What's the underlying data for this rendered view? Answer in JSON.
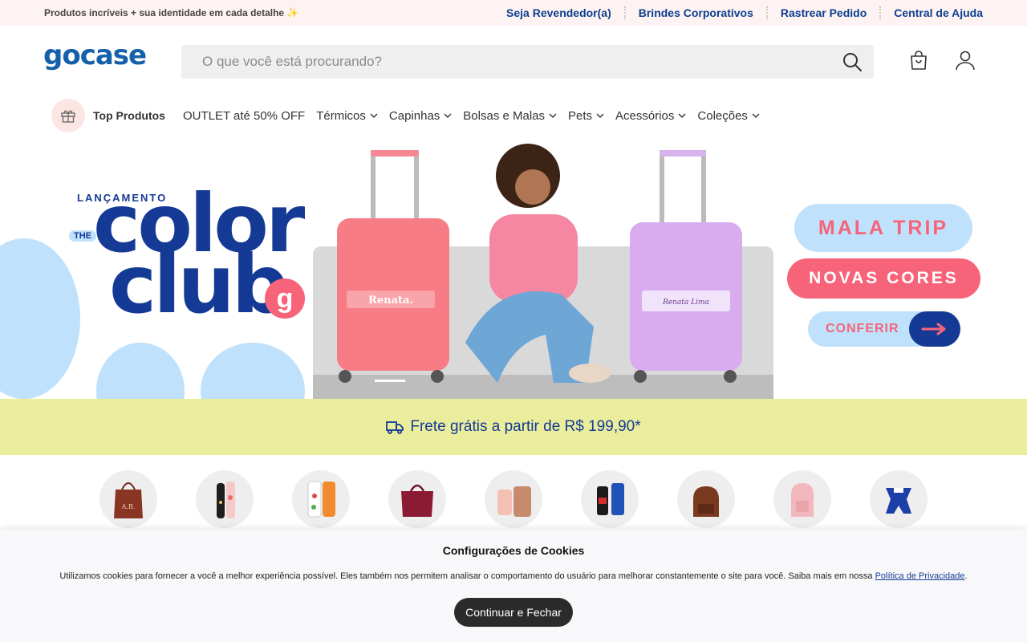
{
  "topbar": {
    "promo": "Produtos incríveis + sua identidade em cada detalhe ✨",
    "links": [
      "Seja Revendedor(a)",
      "Brindes Corporativos",
      "Rastrear Pedido",
      "Central de Ajuda"
    ]
  },
  "header": {
    "logo_text": "gocase",
    "search_placeholder": "O que você está procurando?"
  },
  "nav": {
    "top_label": "Top Produtos",
    "items": [
      "OUTLET até 50% OFF",
      "Térmicos",
      "Capinhas",
      "Bolsas e Malas",
      "Pets",
      "Acessórios",
      "Coleções"
    ]
  },
  "banner": {
    "launch": "LANÇAMENTO",
    "the": "THE",
    "color": "color",
    "club": "club",
    "badge": "g",
    "mala": "MALA TRIP",
    "novas": "NOVAS CORES",
    "cta": "CONFERIR",
    "luggage_name_1": "Renata.",
    "luggage_name_2": "Renata Lima",
    "slides": 2,
    "active_slide": 1
  },
  "shipping": {
    "text": "Frete grátis a partir de R$ 199,90*"
  },
  "categories": [
    {
      "icon": "tote-bag-icon",
      "initials": "A.B."
    },
    {
      "icon": "bottles-icon"
    },
    {
      "icon": "phone-cases-icon"
    },
    {
      "icon": "travel-bag-icon"
    },
    {
      "icon": "luggage-set-icon"
    },
    {
      "icon": "tumblers-icon"
    },
    {
      "icon": "backpack-icon"
    },
    {
      "icon": "pink-backpack-icon"
    },
    {
      "icon": "pet-harness-icon"
    }
  ],
  "cookie": {
    "title": "Configurações de Cookies",
    "text": "Utilizamos cookies para fornecer a você a melhor experiência possível. Eles também nos permitem analisar o comportamento do usuário para melhorar constantemente o site para você. Saiba mais em nossa",
    "link": "Política de Privacidade",
    "period": ".",
    "button": "Continuar e Fechar"
  },
  "colors": {
    "brand_blue": "#143a95",
    "coral": "#f7647a",
    "light_blue": "#bfe1fb",
    "shipping_bg": "#eaed9c"
  }
}
